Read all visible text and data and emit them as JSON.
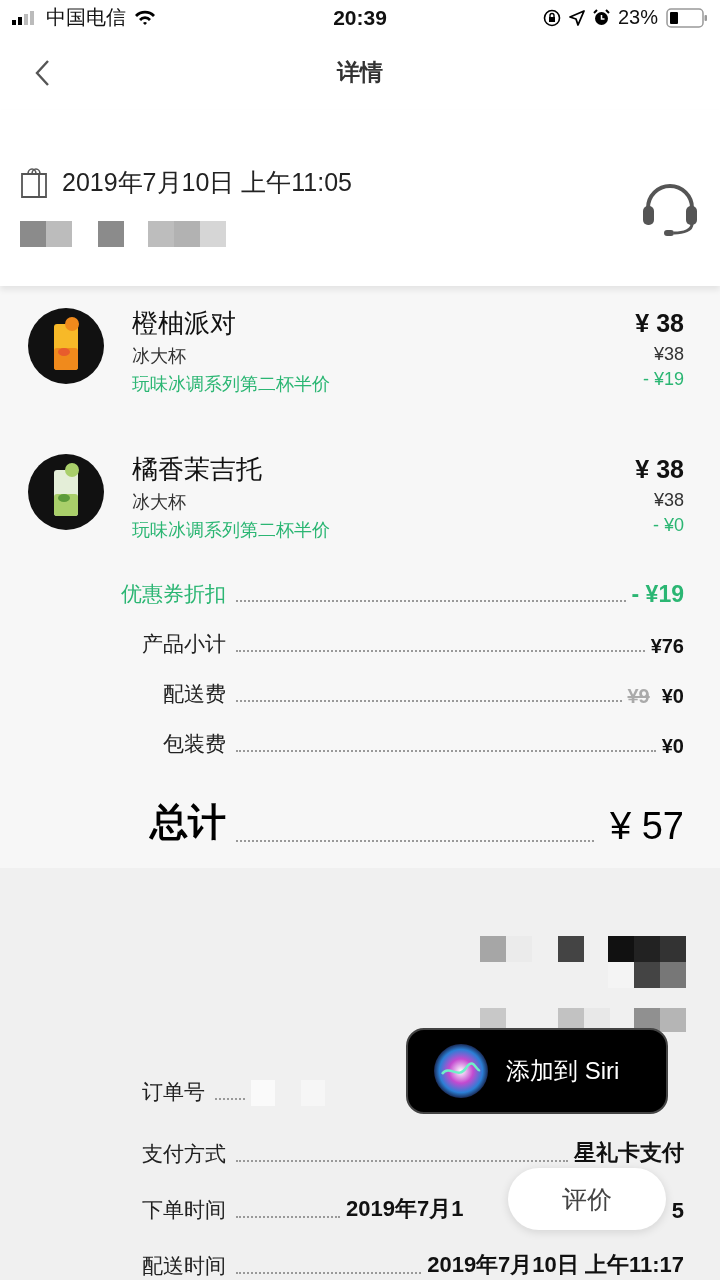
{
  "status_bar": {
    "carrier": "中国电信",
    "time": "20:39",
    "battery": "23%"
  },
  "nav": {
    "title": "详情"
  },
  "order": {
    "date": "2019年7月10日 上午11:05"
  },
  "items": [
    {
      "name": "橙柚派对",
      "size": "冰大杯",
      "promo": "玩味冰调系列第二杯半价",
      "price": "¥ 38",
      "original": "¥38",
      "discount": "- ¥19",
      "kind": "orange"
    },
    {
      "name": "橘香茉吉托",
      "size": "冰大杯",
      "promo": "玩味冰调系列第二杯半价",
      "price": "¥ 38",
      "original": "¥38",
      "discount": "- ¥0",
      "kind": "mojito"
    }
  ],
  "summary": [
    {
      "label": "优惠券折扣",
      "kind": "discount",
      "value": "- ¥19"
    },
    {
      "label": "产品小计",
      "kind": "normal",
      "value": "¥76"
    },
    {
      "label": "配送费",
      "kind": "struck",
      "old_value": "¥9",
      "value": "¥0"
    },
    {
      "label": "包装费",
      "kind": "normal",
      "value": "¥0"
    },
    {
      "label": "总计",
      "kind": "total",
      "value": "¥ 57"
    }
  ],
  "details": [
    {
      "label": "订单号",
      "kind": "redacted"
    },
    {
      "label": "支付方式",
      "kind": "text",
      "value": "星礼卡支付"
    },
    {
      "label": "下单时间",
      "kind": "split",
      "value": "2019年7月1",
      "value_tail": "5"
    },
    {
      "label": "配送时间",
      "kind": "text",
      "value": "2019年7月10日 上午11:17"
    }
  ],
  "siri_popup": {
    "label": "添加到 Siri"
  },
  "review_button": {
    "label": "评价"
  }
}
